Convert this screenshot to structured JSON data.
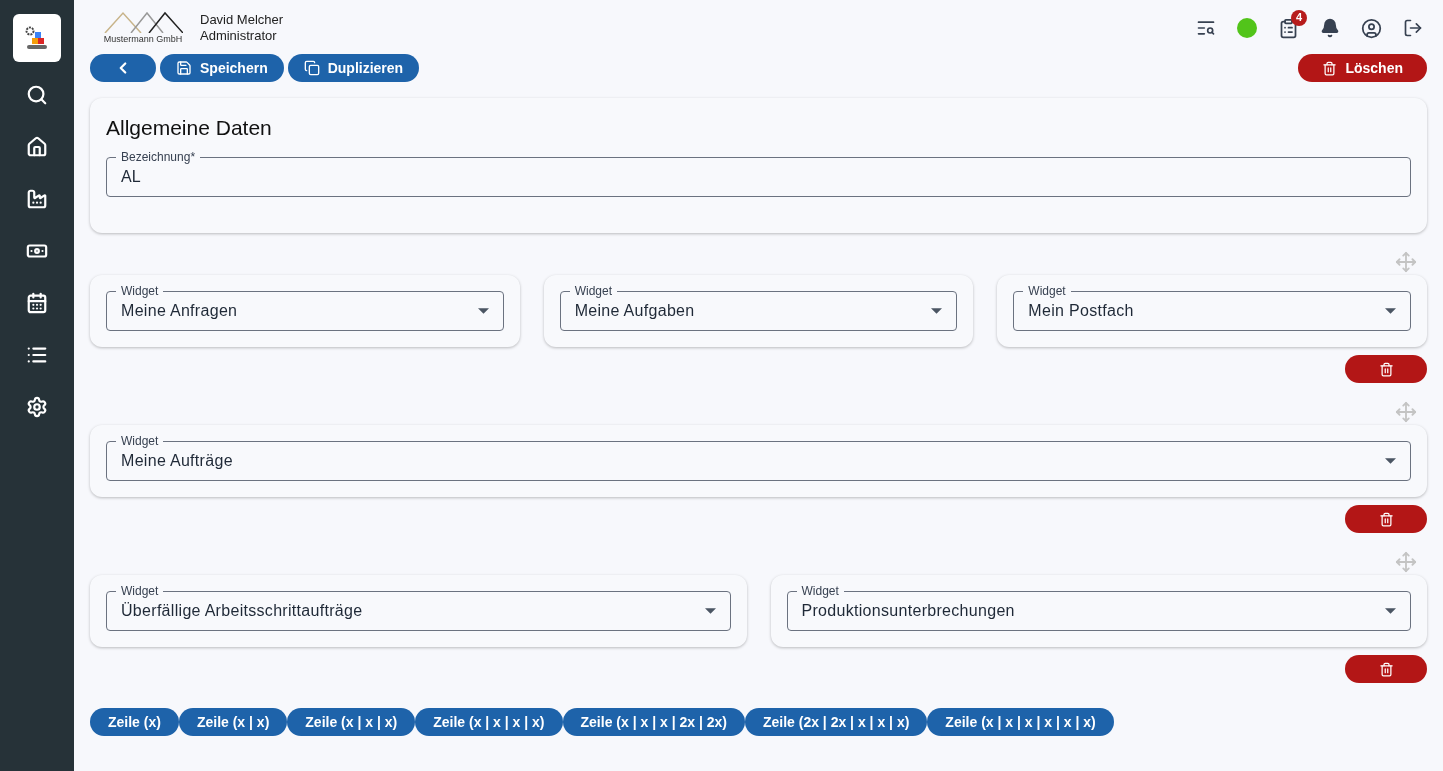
{
  "header": {
    "company": "Mustermann GmbH",
    "user_name": "David Melcher",
    "user_role": "Administrator",
    "notification_count": "4"
  },
  "toolbar": {
    "save": "Speichern",
    "duplicate": "Duplizieren",
    "delete": "Löschen"
  },
  "general": {
    "title": "Allgemeine Daten",
    "field_label": "Bezeichnung*",
    "field_value": "AL"
  },
  "rows": [
    {
      "widgets": [
        {
          "label": "Widget",
          "value": "Meine Anfragen"
        },
        {
          "label": "Widget",
          "value": "Meine Aufgaben"
        },
        {
          "label": "Widget",
          "value": "Mein Postfach"
        }
      ]
    },
    {
      "widgets": [
        {
          "label": "Widget",
          "value": "Meine Aufträge"
        }
      ]
    },
    {
      "widgets": [
        {
          "label": "Widget",
          "value": "Überfällige Arbeitsschrittaufträge"
        },
        {
          "label": "Widget",
          "value": "Produktionsunterbrechungen"
        }
      ]
    }
  ],
  "row_buttons": [
    "Zeile (x)",
    "Zeile (x | x)",
    "Zeile (x | x | x)",
    "Zeile (x | x | x | x)",
    "Zeile (x | x | x | 2x | 2x)",
    "Zeile (2x | 2x | x | x | x)",
    "Zeile (x | x | x | x | x | x)"
  ]
}
